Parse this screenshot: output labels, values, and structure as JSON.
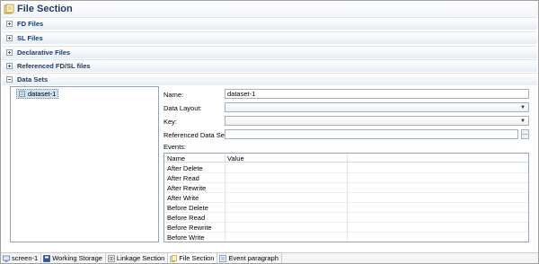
{
  "title": "File Section",
  "sections": [
    {
      "label": "FD Files",
      "expanded": false
    },
    {
      "label": "SL Files",
      "expanded": false
    },
    {
      "label": "Declarative Files",
      "expanded": false
    },
    {
      "label": "Referenced FD/SL files",
      "expanded": false
    },
    {
      "label": "Data Sets",
      "expanded": true
    }
  ],
  "tree": {
    "items": [
      {
        "label": "dataset-1",
        "icon": "dataset-icon"
      }
    ]
  },
  "form": {
    "name_label": "Name:",
    "name_value": "dataset-1",
    "data_layout_label": "Data Layout:",
    "data_layout_value": "",
    "key_label": "Key:",
    "key_value": "",
    "referenced_label": "Referenced Data Sets:",
    "referenced_value": "",
    "browse_label": "...",
    "events_label": "Events:"
  },
  "events_table": {
    "columns": [
      "Name",
      "Value"
    ],
    "rows": [
      {
        "name": "After Delete",
        "value": ""
      },
      {
        "name": "After Read",
        "value": ""
      },
      {
        "name": "After Rewrite",
        "value": ""
      },
      {
        "name": "After Write",
        "value": ""
      },
      {
        "name": "Before Delete",
        "value": ""
      },
      {
        "name": "Before Read",
        "value": ""
      },
      {
        "name": "Before Rewrite",
        "value": ""
      },
      {
        "name": "Before Write",
        "value": ""
      }
    ]
  },
  "bottom_tabs": [
    {
      "label": "screen-1",
      "icon": "screen-icon",
      "active": false
    },
    {
      "label": "Working Storage",
      "icon": "storage-icon",
      "active": false
    },
    {
      "label": "Linkage Section",
      "icon": "linkage-icon",
      "active": false
    },
    {
      "label": "File Section",
      "icon": "file-section-icon",
      "active": true
    },
    {
      "label": "Event paragraph",
      "icon": "event-icon",
      "active": false
    }
  ],
  "colors": {
    "header_text": "#1d3b66",
    "selection": "#cfe3f7"
  }
}
